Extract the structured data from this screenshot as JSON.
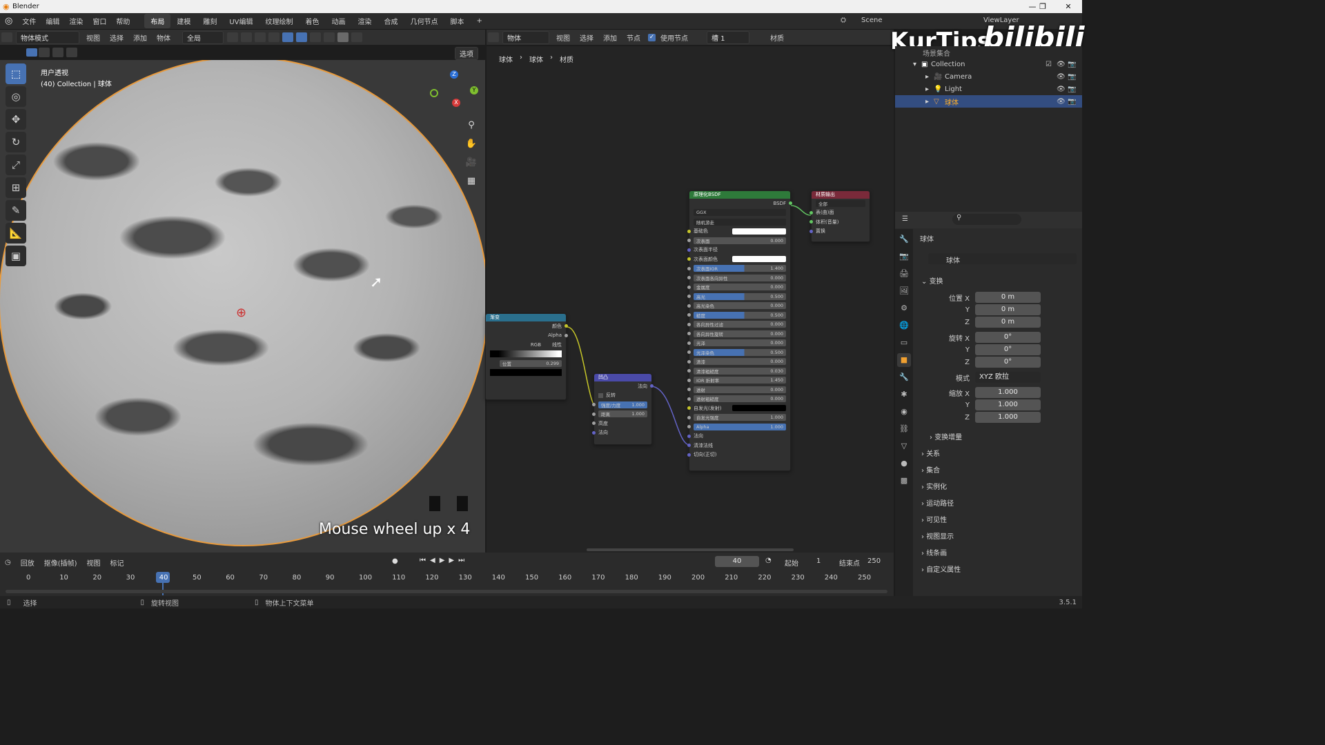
{
  "window": {
    "title": "Blender",
    "min": "—",
    "max": "❐",
    "close": "✕"
  },
  "menubar": {
    "items": [
      "文件",
      "编辑",
      "渲染",
      "窗口",
      "帮助"
    ],
    "workspaces": [
      "布局",
      "建模",
      "雕刻",
      "UV编辑",
      "纹理绘制",
      "着色",
      "动画",
      "渲染",
      "合成",
      "几何节点",
      "脚本"
    ],
    "add_workspace": "+",
    "scene": "Scene",
    "viewlayer": "ViewLayer"
  },
  "viewport_header": {
    "mode": "物体模式",
    "menus": [
      "视图",
      "选择",
      "添加",
      "物体"
    ],
    "transform": "全局",
    "options": "选项"
  },
  "viewport": {
    "view_name": "用户透视",
    "collection_info": "(40) Collection | 球体",
    "overlay_text": "Mouse wheel up x 4",
    "gizmo": {
      "x": "X",
      "y": "Y",
      "z": "Z"
    }
  },
  "node_header": {
    "type": "物体",
    "menus": [
      "视图",
      "选择",
      "添加",
      "节点"
    ],
    "use_nodes": "使用节点",
    "slot": "槽 1",
    "material": "材质"
  },
  "node_breadcrumb": [
    "球体",
    "球体",
    "材质"
  ],
  "nodes": {
    "bsdf": {
      "title": "原理化BSDF",
      "output": "BSDF",
      "dist": "GGX",
      "sss": "随机游走",
      "rows": [
        [
          "基础色",
          ""
        ],
        [
          "次表面",
          "0.000"
        ],
        [
          "次表面半径",
          ""
        ],
        [
          "次表面颜色",
          ""
        ],
        [
          "次表面IOR",
          "1.400"
        ],
        [
          "次表面各向异性",
          "0.000"
        ],
        [
          "金属度",
          "0.000"
        ],
        [
          "高光",
          "0.500"
        ],
        [
          "高光染色",
          "0.000"
        ],
        [
          "糙度",
          "0.500"
        ],
        [
          "各向异性过滤",
          "0.000"
        ],
        [
          "各向异性旋转",
          "0.000"
        ],
        [
          "光泽",
          "0.000"
        ],
        [
          "光泽染色",
          "0.500"
        ],
        [
          "清漆",
          "0.000"
        ],
        [
          "清漆粗糙度",
          "0.030"
        ],
        [
          "IOR 折射率",
          "1.450"
        ],
        [
          "透射",
          "0.000"
        ],
        [
          "透射粗糙度",
          "0.000"
        ],
        [
          "自发光(发射)",
          ""
        ],
        [
          "自发光强度",
          "1.000"
        ],
        [
          "Alpha",
          "1.000"
        ],
        [
          "法向",
          ""
        ],
        [
          "清漆法线",
          ""
        ],
        [
          "切向(正切)",
          ""
        ]
      ]
    },
    "output": {
      "title": "材质输出",
      "target": "全部",
      "rows": [
        "表(曲)面",
        "体积(音量)",
        "置换"
      ]
    },
    "bump": {
      "title": "凹凸",
      "output": "法向",
      "invert": "反转",
      "strength_label": "强度/力度",
      "strength": "1.000",
      "distance_label": "距离",
      "distance": "1.000",
      "height": "高度",
      "normal": "法向"
    },
    "ramp": {
      "title": "渐变",
      "out_color": "颜色",
      "out_alpha": "Alpha",
      "mode": "RGB",
      "interp": "线性",
      "pos_label": "位置",
      "pos": "0.299"
    }
  },
  "watermark": {
    "text1": "KurTips",
    "text2": "bilibili"
  },
  "outliner": {
    "root": "场景集合",
    "collection": "Collection",
    "items": [
      "Camera",
      "Light",
      "球体"
    ]
  },
  "properties": {
    "object_name": "球体",
    "data_name": "球体",
    "section_transform": "变换",
    "location": {
      "label": "位置 X",
      "x": "0 m",
      "y": "0 m",
      "z": "0 m"
    },
    "rotation": {
      "label": "旋转 X",
      "x": "0°",
      "y": "0°",
      "z": "0°"
    },
    "mode_label": "模式",
    "mode": "XYZ 欧拉",
    "scale": {
      "label": "缩放 X",
      "x": "1.000",
      "y": "1.000",
      "z": "1.000"
    },
    "axis_y": "Y",
    "axis_z": "Z",
    "sections": [
      "变换增量",
      "关系",
      "集合",
      "实例化",
      "运动路径",
      "可见性",
      "视图显示",
      "线条画",
      "自定义属性"
    ]
  },
  "timeline": {
    "menus": [
      "回放",
      "抠像(插帧)",
      "视图",
      "标记"
    ],
    "current": "40",
    "start_label": "起始",
    "start": "1",
    "end_label": "结束点",
    "end": "250",
    "ticks": [
      "0",
      "10",
      "20",
      "30",
      "40",
      "50",
      "60",
      "70",
      "80",
      "90",
      "100",
      "110",
      "120",
      "130",
      "140",
      "150",
      "160",
      "170",
      "180",
      "190",
      "200",
      "210",
      "220",
      "230",
      "240",
      "250"
    ]
  },
  "statusbar": {
    "select": "选择",
    "rotate": "旋转视图",
    "context": "物体上下文菜单",
    "version": "3.5.1"
  }
}
